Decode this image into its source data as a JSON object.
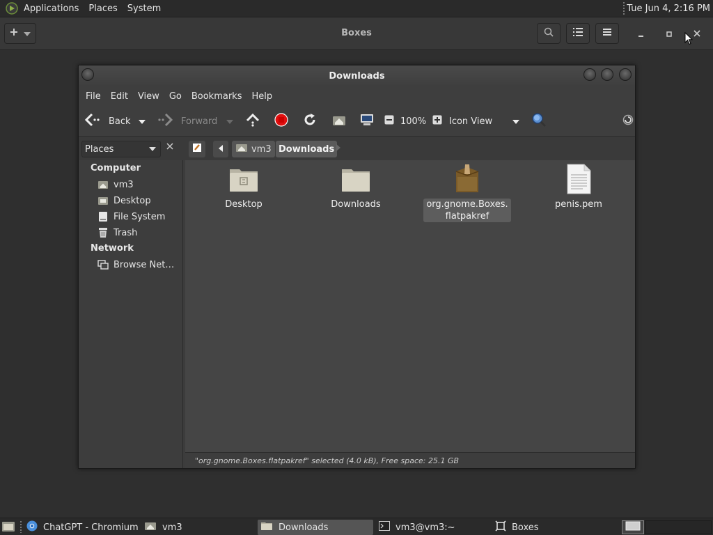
{
  "top_panel": {
    "menus": [
      "Applications",
      "Places",
      "System"
    ],
    "clock": "Tue Jun  4,  2:16 PM"
  },
  "boxes": {
    "title": "Boxes",
    "new_icon": "plus-icon",
    "search_icon": "search-icon",
    "list_view_icon": "list-view-icon",
    "menu_icon": "hamburger-menu-icon"
  },
  "file_manager": {
    "title": "Downloads",
    "menus": [
      "File",
      "Edit",
      "View",
      "Go",
      "Bookmarks",
      "Help"
    ],
    "toolbar": {
      "back": "Back",
      "forward": "Forward",
      "zoom": "100%",
      "view_mode": "Icon View"
    },
    "sidebar_selector": "Places",
    "breadcrumb": [
      "vm3",
      "Downloads"
    ],
    "sidebar": {
      "computer_heading": "Computer",
      "computer_items": [
        {
          "label": "vm3",
          "icon": "home-folder-icon"
        },
        {
          "label": "Desktop",
          "icon": "desktop-folder-icon"
        },
        {
          "label": "File System",
          "icon": "hard-drive-icon"
        },
        {
          "label": "Trash",
          "icon": "trash-icon"
        }
      ],
      "network_heading": "Network",
      "network_items": [
        {
          "label": "Browse Net…",
          "icon": "network-icon"
        }
      ]
    },
    "files": [
      {
        "name": "Desktop",
        "type": "folder",
        "selected": false
      },
      {
        "name": "Downloads",
        "type": "folder",
        "selected": false
      },
      {
        "name_line1": "org.gnome.Boxes.",
        "name_line2": "flatpakref",
        "type": "package",
        "selected": true
      },
      {
        "name": "penis.pem",
        "type": "document",
        "selected": false
      }
    ],
    "status": "\"org.gnome.Boxes.flatpakref\" selected (4.0 kB), Free space: 25.1 GB"
  },
  "taskbar": {
    "tasks": [
      {
        "label": "ChatGPT - Chromium",
        "icon": "chromium-icon",
        "active": false
      },
      {
        "label": "vm3",
        "icon": "home-folder-icon",
        "active": false
      },
      {
        "label": "Downloads",
        "icon": "folder-icon",
        "active": true
      },
      {
        "label": "vm3@vm3:~",
        "icon": "terminal-icon",
        "active": false
      },
      {
        "label": "Boxes",
        "icon": "boxes-icon",
        "active": false
      }
    ]
  },
  "colors": {
    "desktop_bg": "#2f2f2f",
    "panel_bg": "#2a2a2a",
    "content_bg": "#454545",
    "stop_red": "#e01010",
    "folder_tan": "#d8d4c4",
    "package_brown": "#7a5a28"
  }
}
